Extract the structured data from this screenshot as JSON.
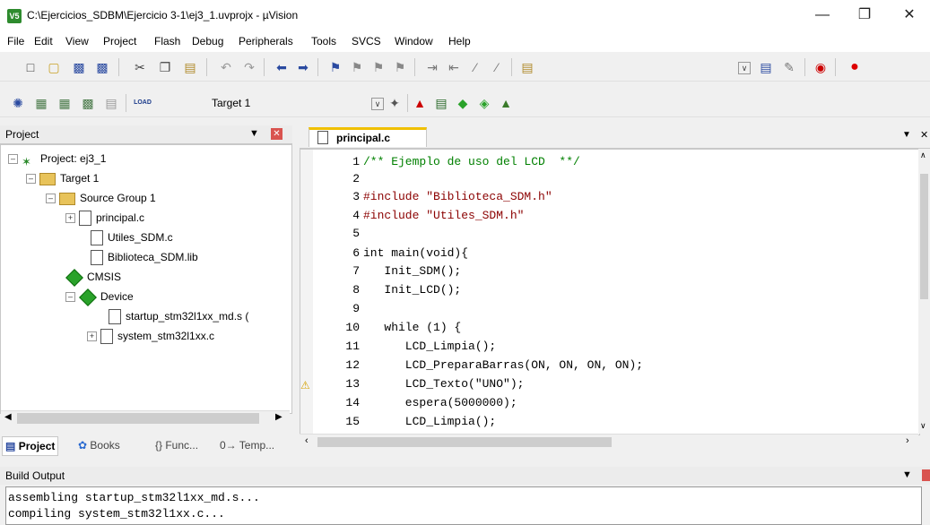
{
  "window": {
    "title": "C:\\Ejercicios_SDBM\\Ejercicio 3-1\\ej3_1.uvprojx - µVision",
    "icon_label": "V5"
  },
  "menu": [
    "File",
    "Edit",
    "View",
    "Project",
    "Flash",
    "Debug",
    "Peripherals",
    "Tools",
    "SVCS",
    "Window",
    "Help"
  ],
  "toolbar2": {
    "target": "Target 1",
    "load_label": "LOAD"
  },
  "project_panel": {
    "title": "Project",
    "tree": [
      {
        "label": "Project: ej3_1"
      },
      {
        "label": "Target 1"
      },
      {
        "label": "Source Group 1"
      },
      {
        "label": "principal.c"
      },
      {
        "label": "Utiles_SDM.c"
      },
      {
        "label": "Biblioteca_SDM.lib"
      },
      {
        "label": "CMSIS"
      },
      {
        "label": "Device"
      },
      {
        "label": "startup_stm32l1xx_md.s ("
      },
      {
        "label": "system_stm32l1xx.c"
      }
    ],
    "tabs": [
      "Project",
      "Books",
      "{} Func...",
      "0→ Temp..."
    ]
  },
  "editor": {
    "tab": "principal.c",
    "lines": [
      {
        "n": "1",
        "text": "/** Ejemplo de uso del LCD  **/"
      },
      {
        "n": "2",
        "text": ""
      },
      {
        "n": "3",
        "text": "#include \"Biblioteca_SDM.h\""
      },
      {
        "n": "4",
        "text": "#include \"Utiles_SDM.h\""
      },
      {
        "n": "5",
        "text": ""
      },
      {
        "n": "6",
        "text": "int main(void){"
      },
      {
        "n": "7",
        "text": "   Init_SDM();"
      },
      {
        "n": "8",
        "text": "   Init_LCD();"
      },
      {
        "n": "9",
        "text": ""
      },
      {
        "n": "10",
        "text": "   while (1) {"
      },
      {
        "n": "11",
        "text": "      LCD_Limpia();"
      },
      {
        "n": "12",
        "text": "      LCD_PreparaBarras(ON, ON, ON, ON);"
      },
      {
        "n": "13",
        "text": "      LCD_Texto(\"UNO\");"
      },
      {
        "n": "14",
        "text": "      espera(5000000);"
      },
      {
        "n": "15",
        "text": "      LCD_Limpia();"
      }
    ]
  },
  "build_output": {
    "title": "Build Output",
    "lines": [
      "assembling startup_stm32l1xx_md.s...",
      "compiling system_stm32l1xx.c..."
    ]
  },
  "icons": {
    "pin": "pin-icon",
    "close": "close-icon"
  },
  "colors": {
    "keyword": "#0000ff",
    "string": "#8b0000",
    "number": "#008080",
    "comment": "#008000",
    "tab_accent": "#f0c000"
  }
}
